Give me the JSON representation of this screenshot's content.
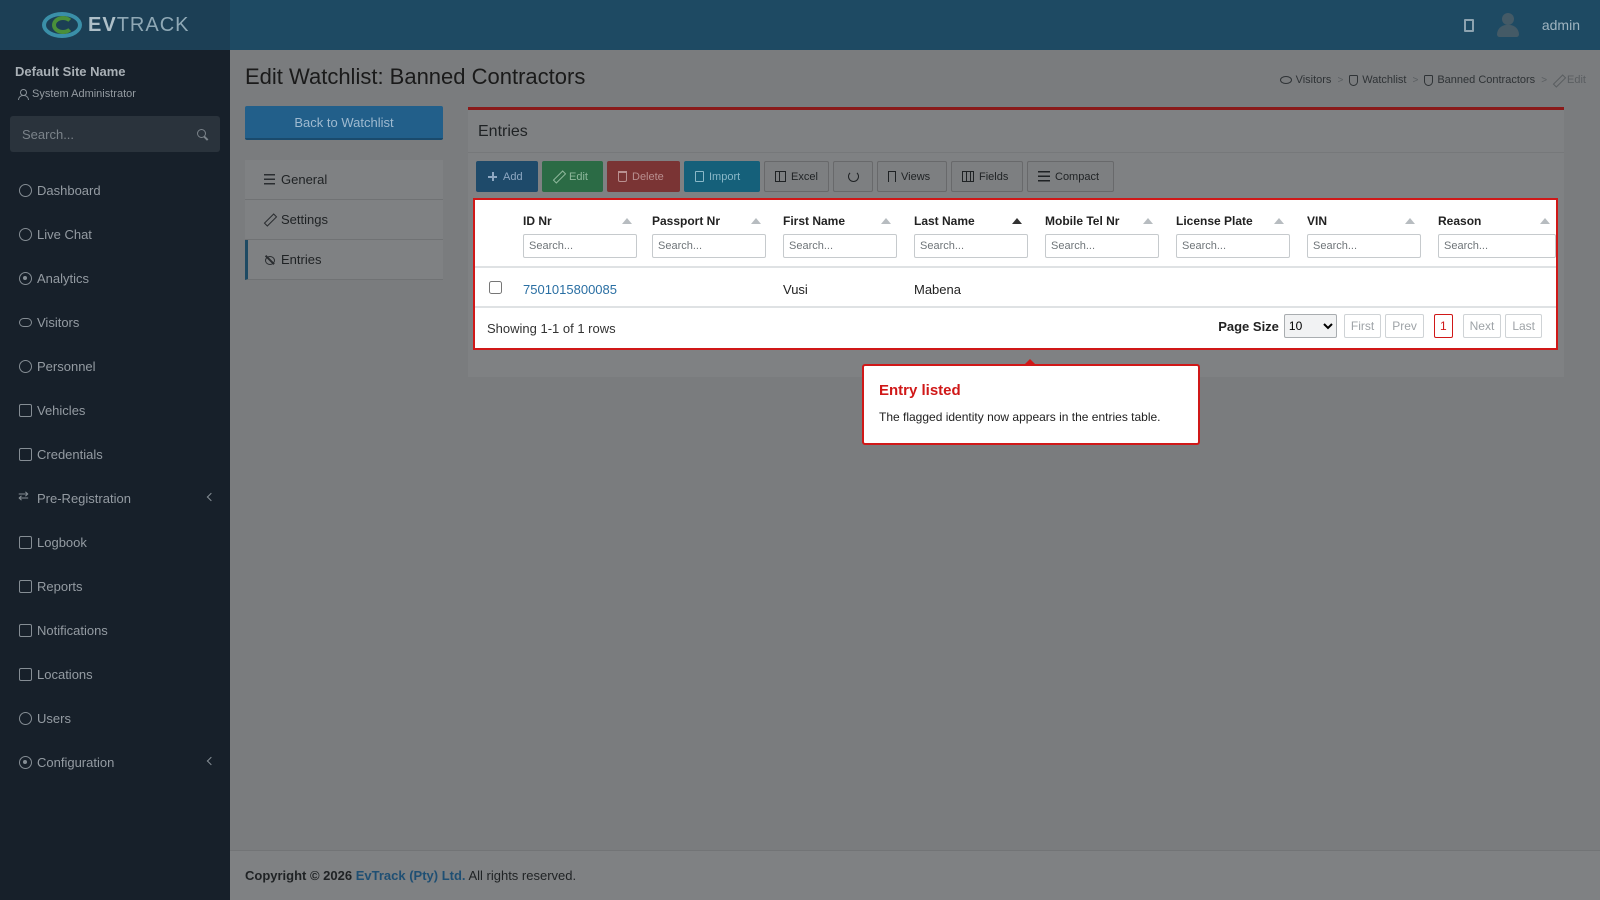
{
  "app": {
    "logo_prefix": "EV",
    "logo_suffix": "TRACK",
    "user": "admin"
  },
  "sidebar": {
    "site_name": "Default Site Name",
    "role": "System Administrator",
    "search_placeholder": "Search...",
    "items": [
      {
        "label": "Dashboard",
        "icon": "dashboard-icon"
      },
      {
        "label": "Live Chat",
        "icon": "headset-icon"
      },
      {
        "label": "Analytics",
        "icon": "target-icon"
      },
      {
        "label": "Visitors",
        "icon": "eye-icon"
      },
      {
        "label": "Personnel",
        "icon": "users-icon"
      },
      {
        "label": "Vehicles",
        "icon": "car-icon"
      },
      {
        "label": "Credentials",
        "icon": "id-card-icon"
      },
      {
        "label": "Pre-Registration",
        "icon": "arrows-icon",
        "expandable": true
      },
      {
        "label": "Logbook",
        "icon": "book-icon"
      },
      {
        "label": "Reports",
        "icon": "chart-icon"
      },
      {
        "label": "Notifications",
        "icon": "chat-icon"
      },
      {
        "label": "Locations",
        "icon": "map-icon"
      },
      {
        "label": "Users",
        "icon": "user-icon"
      },
      {
        "label": "Configuration",
        "icon": "gear-icon",
        "expandable": true
      }
    ]
  },
  "page": {
    "title": "Edit Watchlist: Banned Contractors",
    "breadcrumb": [
      "Visitors",
      "Watchlist",
      "Banned Contractors",
      "Edit"
    ],
    "back_label": "Back to Watchlist",
    "sub_nav": [
      "General",
      "Settings",
      "Entries"
    ],
    "active_sub": "Entries"
  },
  "entries": {
    "title": "Entries",
    "toolbar": {
      "add": "Add",
      "edit": "Edit",
      "delete": "Delete",
      "import": "Import",
      "excel": "Excel",
      "views": "Views",
      "fields": "Fields",
      "compact": "Compact"
    },
    "columns": [
      "ID Nr",
      "Passport Nr",
      "First Name",
      "Last Name",
      "Mobile Tel Nr",
      "License Plate",
      "VIN",
      "Reason"
    ],
    "search_placeholder": "Search...",
    "rows": [
      {
        "id_nr": "7501015800085",
        "passport_nr": "",
        "first_name": "Vusi",
        "last_name": "Mabena",
        "mobile": "",
        "plate": "",
        "vin": "",
        "reason": ""
      }
    ],
    "showing": "Showing 1-1 of 1 rows",
    "page_size_label": "Page Size",
    "page_size": "10",
    "pager": {
      "first": "First",
      "prev": "Prev",
      "current": "1",
      "next": "Next",
      "last": "Last"
    }
  },
  "tooltip": {
    "title": "Entry listed",
    "text": "The flagged identity now appears in the entries table."
  },
  "footer": {
    "prefix": "Copyright © 2026",
    "company": "EvTrack (Pty) Ltd.",
    "suffix": "All rights reserved."
  },
  "colors": {
    "highlight": "#d01818",
    "header": "#1e4a63",
    "sidebar": "#17202a"
  }
}
